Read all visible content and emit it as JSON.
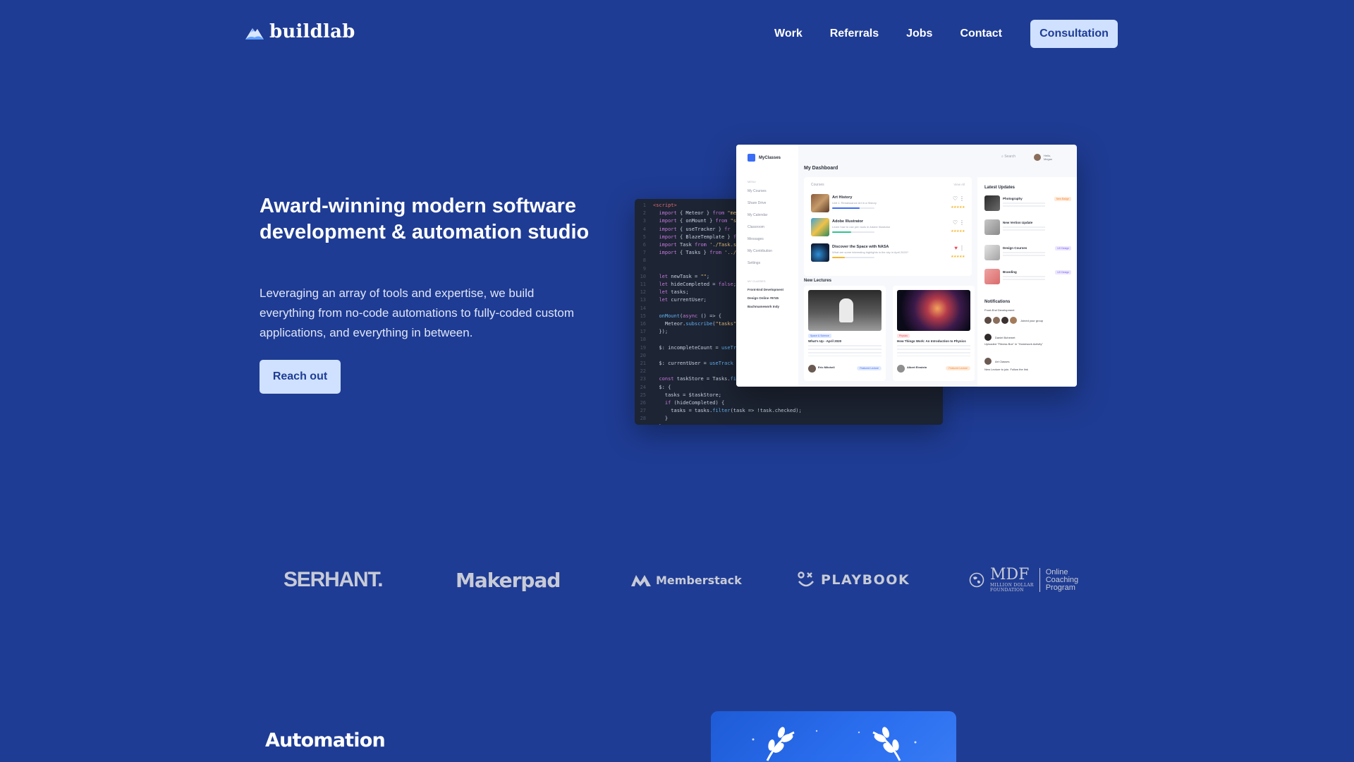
{
  "header": {
    "brand": "buildlab",
    "nav": [
      "Work",
      "Referrals",
      "Jobs",
      "Contact"
    ],
    "cta_label": "Consultation"
  },
  "hero": {
    "title": "Award-winning modern software development & automation studio",
    "text": "Leveraging an array of tools and expertise, we build everything from no-code automations to fully-coded custom applications, and everything in between.",
    "button_label": "Reach out"
  },
  "dashboard": {
    "brand": "MyClasses",
    "title": "My Dashboard",
    "search_placeholder": "Search",
    "user": [
      "Hello,",
      "Megan"
    ],
    "sidebar_group": "MENU",
    "sidebar_items": [
      "My Courses",
      "Share Drive",
      "My Calendar",
      "Classroom",
      "Messages",
      "My Contribution",
      "Settings"
    ],
    "sidebar_sub_group": "MY CLASSES",
    "sidebar_sub": [
      "Front-End Development",
      "Design Online #9745",
      "Bachmamework Indy"
    ],
    "courses_label": "Courses",
    "view_all": "View All",
    "courses": [
      {
        "name": "Art History",
        "desc": "Unit 1: Renaissance Art in a History",
        "progress": 0.65
      },
      {
        "name": "Adobe Illustrator",
        "desc": "Learn how to use pen tools in Adobe Illustrator",
        "progress": 0.45
      },
      {
        "name": "Discover the Space with NASA",
        "desc": "What are some interesting highlights in the sky in April 2020?",
        "progress": 0.3
      }
    ],
    "lectures_title": "New Lectures",
    "lectures": [
      {
        "tag": "Space & Science",
        "name": "What's Up - April 2020",
        "author": "Eric Mitchell",
        "pill": "Featured Lecture"
      },
      {
        "tag": "Physics",
        "name": "How Things Work: An Introduction to Physics",
        "author": "Albert Einstein",
        "pill": "Featured Lecture"
      }
    ],
    "updates_title": "Latest Updates",
    "updates": [
      {
        "name": "Photography",
        "tag": "New Badge"
      },
      {
        "name": "New Vertion Update",
        "tag": ""
      },
      {
        "name": "Design Courses",
        "tag": "UX Design"
      },
      {
        "name": "Branding",
        "tag": "UX Design"
      }
    ],
    "notifications_title": "Notifications",
    "notifications": [
      "Front-End Development",
      "Joined your group",
      "Daniel Bohemet",
      "Uploaded \"Fitness Box\" in \"Homework Activity\"",
      "Art Classes",
      "New Lecture to join. Follow the link"
    ]
  },
  "clients": {
    "serhant": "SERHANT.",
    "makerpad": "Makerpad",
    "memberstack": "Memberstack",
    "playbook": "PLAYBOOK",
    "mdf_mark": "MDF",
    "mdf_sub": [
      "MILLION DOLLAR",
      "FOUNDATION"
    ],
    "mdf_program": [
      "Online",
      "Coaching",
      "Program"
    ]
  },
  "automation": {
    "title": "Automation"
  },
  "colors": {
    "background": "#1f3c94",
    "button_bg": "#cfe1ff",
    "button_text": "#1f3c94",
    "logo_gray": "#c7cbd6"
  }
}
